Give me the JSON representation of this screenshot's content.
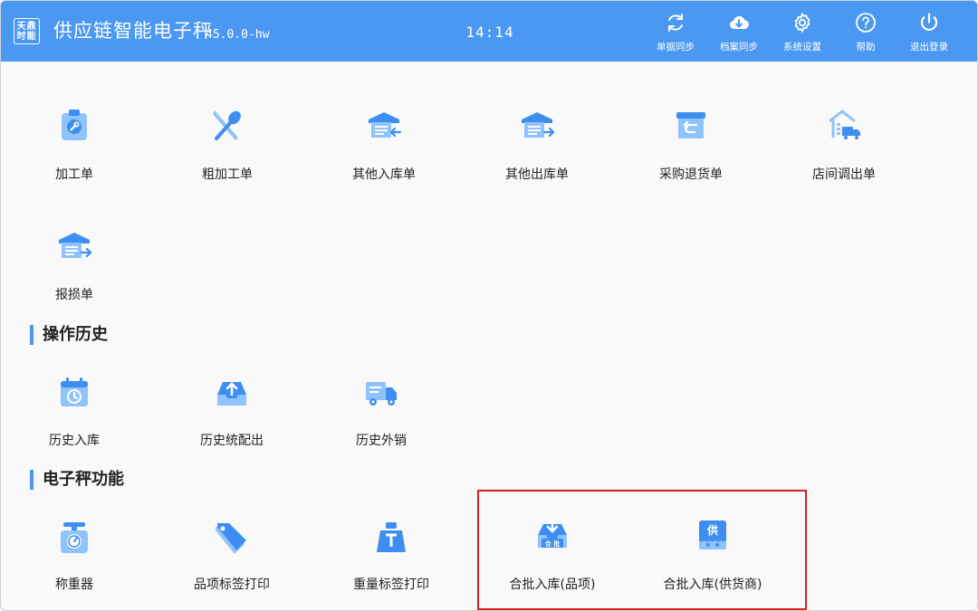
{
  "header": {
    "logo_top": "天鼎",
    "logo_bottom": "时能",
    "title": "供应链智能电子秤",
    "version": "45.0.0-hw",
    "time": "14:14",
    "actions": [
      {
        "label": "单据同步",
        "icon": "refresh-icon"
      },
      {
        "label": "档案同步",
        "icon": "cloud-download-icon"
      },
      {
        "label": "系统设置",
        "icon": "gear-icon"
      },
      {
        "label": "帮助",
        "icon": "help-icon"
      },
      {
        "label": "退出登录",
        "icon": "power-icon"
      }
    ]
  },
  "documents": {
    "items": [
      {
        "label": "加工单",
        "icon": "clipboard-wrench-icon"
      },
      {
        "label": "粗加工单",
        "icon": "knife-tools-icon"
      },
      {
        "label": "其他入库单",
        "icon": "warehouse-in-icon"
      },
      {
        "label": "其他出库单",
        "icon": "warehouse-out-icon"
      },
      {
        "label": "采购退货单",
        "icon": "return-box-icon"
      },
      {
        "label": "店间调出单",
        "icon": "store-transfer-icon"
      },
      {
        "label": "报损单",
        "icon": "warehouse-loss-icon"
      }
    ]
  },
  "history": {
    "title": "操作历史",
    "items": [
      {
        "label": "历史入库",
        "icon": "calendar-history-icon"
      },
      {
        "label": "历史统配出",
        "icon": "inbox-upload-icon"
      },
      {
        "label": "历史外销",
        "icon": "delivery-truck-icon"
      }
    ]
  },
  "scale": {
    "title": "电子秤功能",
    "items": [
      {
        "label": "称重器",
        "icon": "scale-icon"
      },
      {
        "label": "品项标签打印",
        "icon": "tag-icon"
      },
      {
        "label": "重量标签打印",
        "icon": "weight-icon"
      },
      {
        "label": "合批入库(品项)",
        "icon": "batch-inbound-item-icon",
        "badge": "合 批"
      },
      {
        "label": "合批入库(供货商)",
        "icon": "batch-inbound-supplier-icon",
        "badge": "供"
      }
    ]
  },
  "colors": {
    "header": "#4b98f2",
    "icon_light": "#8fc3fb",
    "icon_dark": "#3d8ef0",
    "highlight": "#d91e1e"
  }
}
